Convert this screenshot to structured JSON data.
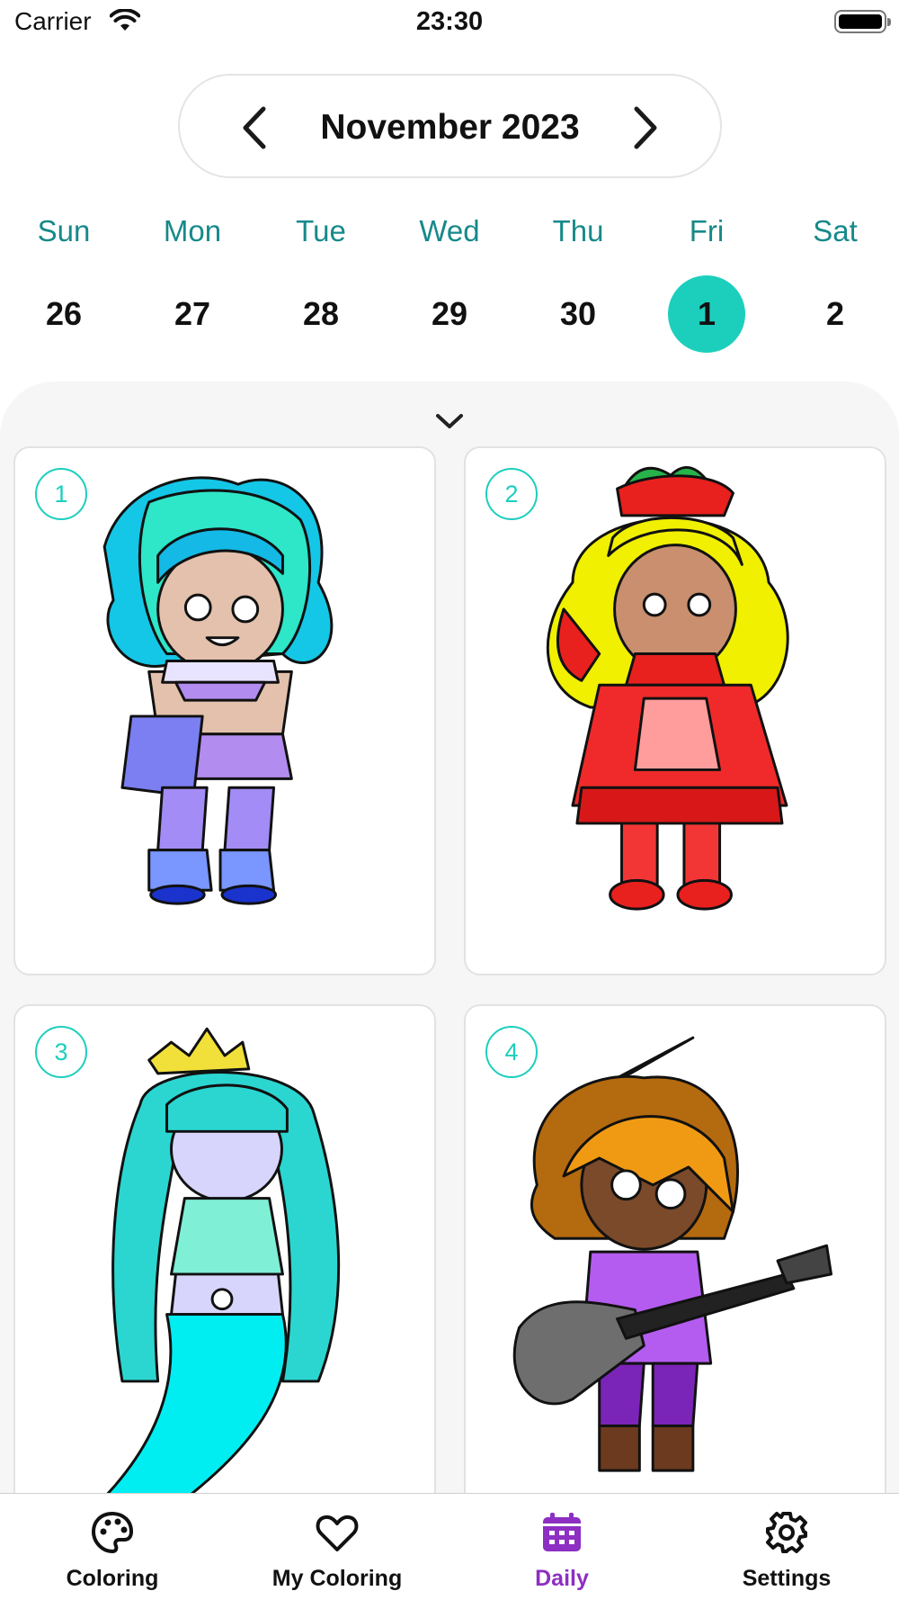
{
  "status_bar": {
    "carrier": "Carrier",
    "time": "23:30"
  },
  "calendar": {
    "month_label": "November 2023",
    "weekdays": [
      "Sun",
      "Mon",
      "Tue",
      "Wed",
      "Thu",
      "Fri",
      "Sat"
    ],
    "days": [
      "26",
      "27",
      "28",
      "29",
      "30",
      "1",
      "2"
    ],
    "selected_day": "1"
  },
  "cards": [
    {
      "number": "1",
      "subject": "blue-green-haired girl with bag"
    },
    {
      "number": "2",
      "subject": "blonde girl in red dress"
    },
    {
      "number": "3",
      "subject": "mermaid with crown"
    },
    {
      "number": "4",
      "subject": "girl with guitar"
    }
  ],
  "tabs": [
    {
      "label": "Coloring",
      "icon": "palette-icon"
    },
    {
      "label": "My Coloring",
      "icon": "heart-icon"
    },
    {
      "label": "Daily",
      "icon": "calendar-icon"
    },
    {
      "label": "Settings",
      "icon": "gear-icon"
    }
  ],
  "active_tab": "Daily",
  "colors": {
    "accent": "#1ccfbd",
    "weekday_text": "#17898a",
    "active_tab": "#8c2fc2",
    "sheet_background": "#f6f6f6"
  }
}
